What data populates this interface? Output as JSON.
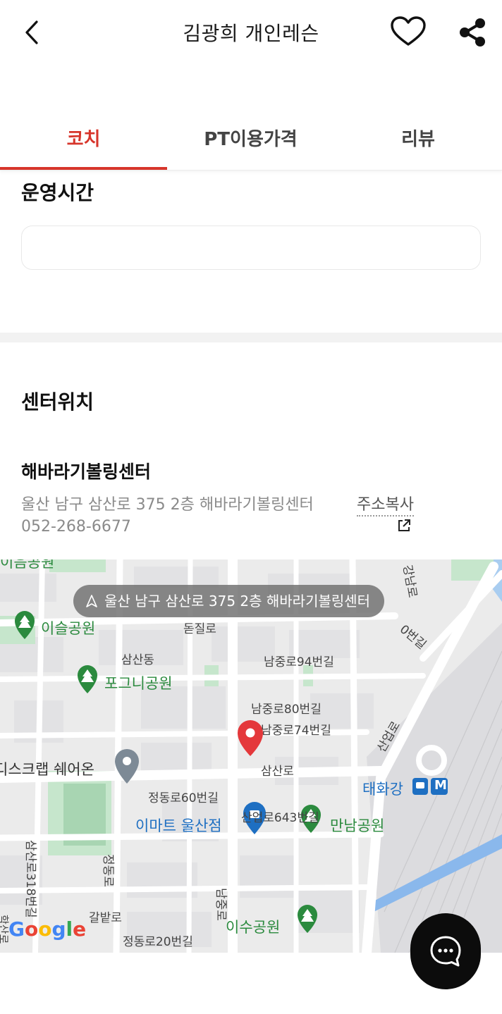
{
  "header": {
    "title": "김광희 개인레슨"
  },
  "tabs": [
    {
      "label": "코치",
      "active": true
    },
    {
      "label": "PT이용가격",
      "active": false
    },
    {
      "label": "리뷰",
      "active": false
    }
  ],
  "hours": {
    "title": "운영시간",
    "value": ""
  },
  "location": {
    "title": "센터위치",
    "center_name": "해바라기볼링센터",
    "address": "울산 남구 삼산로 375 2층 해바라기볼링센터",
    "copy_label": "주소복사",
    "phone": "052-268-6677"
  },
  "map": {
    "address_pill": "울산 남구 삼산로 375 2층 해바라기볼링센터",
    "labels": {
      "top_park": "이음공원",
      "isul_park": "이슬공원",
      "donjil": "돋질로",
      "samsan_dong": "삼산동",
      "namjung94": "남중로94번길",
      "pogeuni_park": "포그니공원",
      "namjung80": "남중로80번길",
      "namjung74": "남중로74번길",
      "scrap": "디스크랩 쉐어온",
      "samsanro": "삼산로",
      "jeongdong60": "정동로60번길",
      "emart": "이마트 울산점",
      "saneop643": "산업로643번길",
      "mannam_park": "만남공원",
      "taehwagang": "태화강",
      "saneopro": "산업로",
      "road_top_right": "강남로",
      "road_right": "0번길",
      "samsan318": "삼산로318번길",
      "jeongdongro": "정동로",
      "galbat": "갈밭로",
      "jeongdong20": "정동로20번길",
      "isu_park": "이수공원",
      "namjung": "남중로",
      "haksan": "학산로",
      "metro_badge": "M"
    },
    "attribution": "Google"
  },
  "colors": {
    "accent": "#d7352b",
    "park": "#2b8a3e",
    "poi_blue": "#1e6fc2",
    "fab": "#0c0c0c"
  }
}
